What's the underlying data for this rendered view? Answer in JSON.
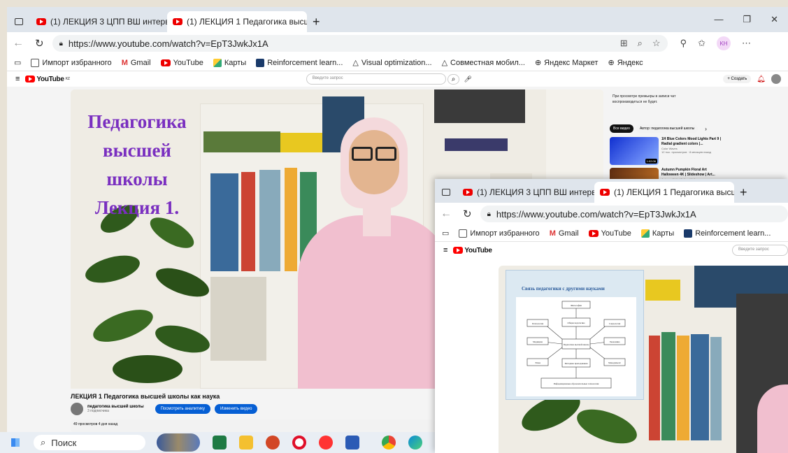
{
  "browser_back": {
    "tabs": [
      {
        "title": "(1) ЛЕКЦИЯ 3 ЦПП ВШ интервью"
      },
      {
        "title": "(1) ЛЕКЦИЯ 1 Педагогика высше"
      }
    ],
    "url": "https://www.youtube.com/watch?v=EpT3JwkJx1A",
    "bookmarks": [
      "Импорт избранного",
      "Gmail",
      "YouTube",
      "Карты",
      "Reinforcement learn...",
      "Visual optimization...",
      "Совместная мобил...",
      "Яндекс Маркет",
      "Яндекс"
    ],
    "profile_initials": "KH"
  },
  "youtube": {
    "logo": "YouTube",
    "logo_sup": "KZ",
    "search_placeholder": "Введите запрос",
    "create_label": "Создать",
    "notification_count": "9",
    "video_overlay_title": [
      "Педагогика",
      "высшей",
      "школы",
      "Лекция 1."
    ],
    "video_title": "ЛЕКЦИЯ 1 Педагогика высшей школы как наука",
    "channel_name": "педагогика высшей школы",
    "subscribers": "3 подписчика",
    "btn_analytics": "Посмотреть аналитику",
    "btn_edit": "Изменить видео",
    "views": "49 просмотров  4 дня назад",
    "chat_note": "При просмотре премьеры в записи чат воспроизводиться не будет.",
    "filters": [
      "Все видео",
      "Автор: педагогика высшей школы"
    ],
    "recommendations": [
      {
        "title": "1H Blue Colors Mood Lights Part 9 | Radial gradient colors |...",
        "channel": "Color Waves",
        "meta": "12 тыс. просмотров · 8 месяцев назад",
        "duration": "1:02:06"
      },
      {
        "title": "Autumn Pumpkin Floral Art Halloween 4K | Slideshow | Art...",
        "channel": "Autumn 4K Art Gallery Wallpaper",
        "meta": "",
        "duration": ""
      }
    ]
  },
  "browser_front": {
    "tabs": [
      {
        "title": "(1) ЛЕКЦИЯ 3 ЦПП ВШ интервью"
      },
      {
        "title": "(1) ЛЕКЦИЯ 1 Педагогика высше"
      }
    ],
    "url": "https://www.youtube.com/watch?v=EpT3JwkJx1A",
    "bookmarks": [
      "Импорт избранного",
      "Gmail",
      "YouTube",
      "Карты",
      "Reinforcement learn..."
    ],
    "search_placeholder": "Введите запрос"
  },
  "slide": {
    "title": "Связь педагогики с другими науками",
    "nodes": [
      "Философия",
      "Общая педагогика",
      "Психология",
      "Социология",
      "Медицина",
      "Педагогика высшей школы",
      "Экономика",
      "Этика",
      "Методика преподавания",
      "Менеджмент",
      "Информационные образовательные технологии"
    ]
  },
  "taskbar": {
    "search_label": "Поиск"
  },
  "colors": {
    "title_purple": "#7a2fc0",
    "yt_red": "#ff0000",
    "button_blue": "#065fd4",
    "jacket_pink": "#f1bfcf"
  }
}
